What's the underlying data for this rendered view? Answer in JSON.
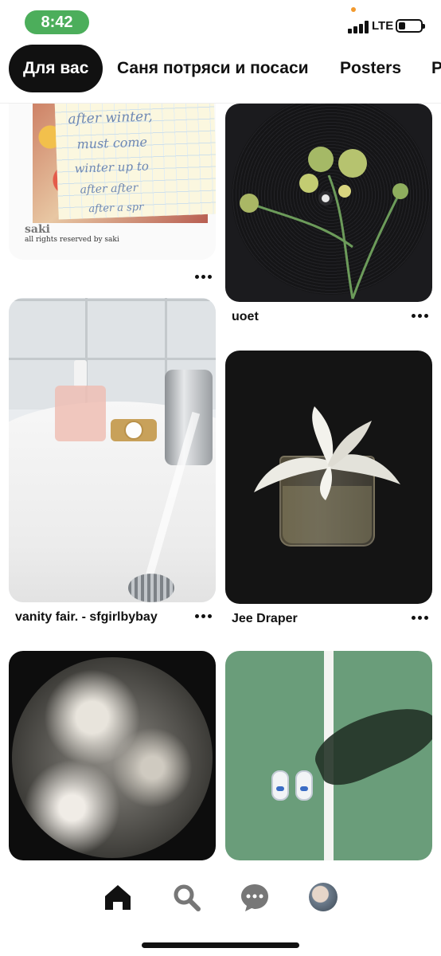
{
  "status_bar": {
    "time": "8:42",
    "network": "LTE",
    "icons": [
      "signal-icon",
      "battery-icon"
    ]
  },
  "tabs": [
    {
      "label": "Для вас",
      "active": true
    },
    {
      "label": "Саня потряси и посаси",
      "active": false
    },
    {
      "label": "Posters",
      "active": false
    },
    {
      "label": "P",
      "active": false
    }
  ],
  "feed": {
    "pins": [
      {
        "title": "",
        "image": "handwritten-note-collage",
        "signature": "saki",
        "caption": "all rights reserved by saki",
        "more_icon": "more-icon"
      },
      {
        "title": "uoet",
        "image": "vinyl-record-with-flowers",
        "more_icon": "more-icon"
      },
      {
        "title": "vanity fair. - sfgirlbybay",
        "image": "bathroom-sink",
        "more_icon": "more-icon"
      },
      {
        "title": "Jee Draper",
        "image": "lily-in-glass",
        "more_icon": "more-icon"
      },
      {
        "title": "",
        "image": "circular-fresco-painting"
      },
      {
        "title": "",
        "image": "tennis-court-shadow"
      }
    ],
    "note_text": [
      "after winter,",
      "must come",
      "winter up to",
      "after after",
      "after a spr"
    ]
  },
  "bottom_nav": {
    "items": [
      "home-icon",
      "search-icon",
      "chat-icon",
      "profile-avatar"
    ]
  },
  "colors": {
    "accent_active_tab": "#111111",
    "time_pill": "#4cae5b",
    "background": "#ffffff"
  }
}
